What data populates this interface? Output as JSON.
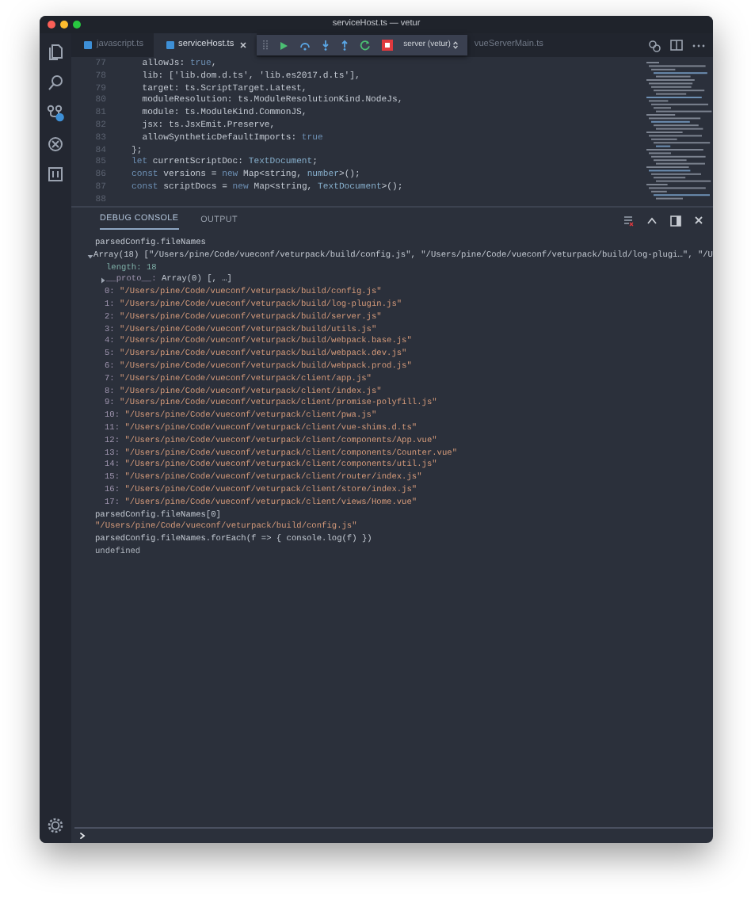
{
  "window": {
    "title": "serviceHost.ts — vetur"
  },
  "tabs": [
    {
      "label": "javascript.ts",
      "selected": false
    },
    {
      "label": "serviceHost.ts",
      "selected": true
    },
    {
      "label": "vueServerMain.ts",
      "selected": false
    }
  ],
  "debug_toolbar": {
    "configuration": "server (vetur)"
  },
  "editor": {
    "lines": [
      {
        "number": "77",
        "tokens": [
          {
            "text": "  allowJs: ",
            "kind": "plain"
          },
          {
            "text": "true",
            "kind": "keyword"
          },
          {
            "text": ",",
            "kind": "plain"
          }
        ]
      },
      {
        "number": "78",
        "tokens": [
          {
            "text": "  lib: ['lib.dom.d.ts', 'lib.es2017.d.ts'],",
            "kind": "plain"
          }
        ]
      },
      {
        "number": "79",
        "tokens": [
          {
            "text": "  target: ts.ScriptTarget.Latest,",
            "kind": "plain"
          }
        ]
      },
      {
        "number": "80",
        "tokens": [
          {
            "text": "  moduleResolution: ts.ModuleResolutionKind.NodeJs,",
            "kind": "plain"
          }
        ]
      },
      {
        "number": "81",
        "tokens": [
          {
            "text": "  module: ts.ModuleKind.CommonJS,",
            "kind": "plain"
          }
        ]
      },
      {
        "number": "82",
        "tokens": [
          {
            "text": "  jsx: ts.JsxEmit.Preserve,",
            "kind": "plain"
          }
        ]
      },
      {
        "number": "83",
        "tokens": [
          {
            "text": "  allowSyntheticDefaultImports: ",
            "kind": "plain"
          },
          {
            "text": "true",
            "kind": "keyword"
          }
        ]
      },
      {
        "number": "84",
        "tokens": [
          {
            "text": "};",
            "kind": "plain"
          }
        ]
      },
      {
        "number": "85",
        "tokens": [
          {
            "text": "let",
            "kind": "keyword"
          },
          {
            "text": " currentScriptDoc: ",
            "kind": "plain"
          },
          {
            "text": "TextDocument",
            "kind": "type"
          },
          {
            "text": ";",
            "kind": "plain"
          }
        ]
      },
      {
        "number": "86",
        "tokens": [
          {
            "text": "const",
            "kind": "keyword"
          },
          {
            "text": " versions = ",
            "kind": "plain"
          },
          {
            "text": "new",
            "kind": "keyword"
          },
          {
            "text": " Map<string, ",
            "kind": "plain"
          },
          {
            "text": "number",
            "kind": "type"
          },
          {
            "text": ">();",
            "kind": "plain"
          }
        ]
      },
      {
        "number": "87",
        "tokens": [
          {
            "text": "const",
            "kind": "keyword"
          },
          {
            "text": " scriptDocs = ",
            "kind": "plain"
          },
          {
            "text": "new",
            "kind": "keyword"
          },
          {
            "text": " Map<string, ",
            "kind": "plain"
          },
          {
            "text": "TextDocument",
            "kind": "type"
          },
          {
            "text": ">();",
            "kind": "plain"
          }
        ]
      },
      {
        "number": "88"
      }
    ]
  },
  "panel": {
    "tabs": [
      {
        "label": "DEBUG CONSOLE",
        "selected": true
      },
      {
        "label": "OUTPUT",
        "selected": false
      }
    ],
    "console": [
      {
        "kind": "input",
        "text": "parsedConfig.fileNames"
      },
      {
        "kind": "object",
        "expanded": true,
        "text": "Array(18) [\"/Users/pine/Code/vueconf/veturpack/build/config.js\", \"/Users/pine/Code/vueconf/veturpack/build/log-plugi…\", \"/U",
        "children": [
          {
            "kind": "property",
            "key": "length:",
            "value": "18"
          },
          {
            "kind": "object",
            "expanded": false,
            "key": "__proto__:",
            "text": "Array(0) [, …]"
          },
          {
            "kind": "item",
            "key": "0:",
            "value": "\"/Users/pine/Code/vueconf/veturpack/build/config.js\""
          },
          {
            "kind": "item",
            "key": "1:",
            "value": "\"/Users/pine/Code/vueconf/veturpack/build/log-plugin.js\""
          },
          {
            "kind": "item",
            "key": "2:",
            "value": "\"/Users/pine/Code/vueconf/veturpack/build/server.js\""
          },
          {
            "kind": "item",
            "key": "3:",
            "value": "\"/Users/pine/Code/vueconf/veturpack/build/utils.js\""
          },
          {
            "kind": "item",
            "key": "4:",
            "value": "\"/Users/pine/Code/vueconf/veturpack/build/webpack.base.js\""
          },
          {
            "kind": "item",
            "key": "5:",
            "value": "\"/Users/pine/Code/vueconf/veturpack/build/webpack.dev.js\""
          },
          {
            "kind": "item",
            "key": "6:",
            "value": "\"/Users/pine/Code/vueconf/veturpack/build/webpack.prod.js\""
          },
          {
            "kind": "item",
            "key": "7:",
            "value": "\"/Users/pine/Code/vueconf/veturpack/client/app.js\""
          },
          {
            "kind": "item",
            "key": "8:",
            "value": "\"/Users/pine/Code/vueconf/veturpack/client/index.js\""
          },
          {
            "kind": "item",
            "key": "9:",
            "value": "\"/Users/pine/Code/vueconf/veturpack/client/promise-polyfill.js\""
          },
          {
            "kind": "item",
            "key": "10:",
            "value": "\"/Users/pine/Code/vueconf/veturpack/client/pwa.js\""
          },
          {
            "kind": "item",
            "key": "11:",
            "value": "\"/Users/pine/Code/vueconf/veturpack/client/vue-shims.d.ts\""
          },
          {
            "kind": "item",
            "key": "12:",
            "value": "\"/Users/pine/Code/vueconf/veturpack/client/components/App.vue\""
          },
          {
            "kind": "item",
            "key": "13:",
            "value": "\"/Users/pine/Code/vueconf/veturpack/client/components/Counter.vue\""
          },
          {
            "kind": "item",
            "key": "14:",
            "value": "\"/Users/pine/Code/vueconf/veturpack/client/components/util.js\""
          },
          {
            "kind": "item",
            "key": "15:",
            "value": "\"/Users/pine/Code/vueconf/veturpack/client/router/index.js\""
          },
          {
            "kind": "item",
            "key": "16:",
            "value": "\"/Users/pine/Code/vueconf/veturpack/client/store/index.js\""
          },
          {
            "kind": "item",
            "key": "17:",
            "value": "\"/Users/pine/Code/vueconf/veturpack/client/views/Home.vue\""
          }
        ]
      },
      {
        "kind": "input",
        "text": "parsedConfig.fileNames[0]"
      },
      {
        "kind": "string",
        "text": "\"/Users/pine/Code/vueconf/veturpack/build/config.js\""
      },
      {
        "kind": "input",
        "text": "parsedConfig.fileNames.forEach(f => { console.log(f) })"
      },
      {
        "kind": "result",
        "text": "undefined"
      }
    ]
  }
}
